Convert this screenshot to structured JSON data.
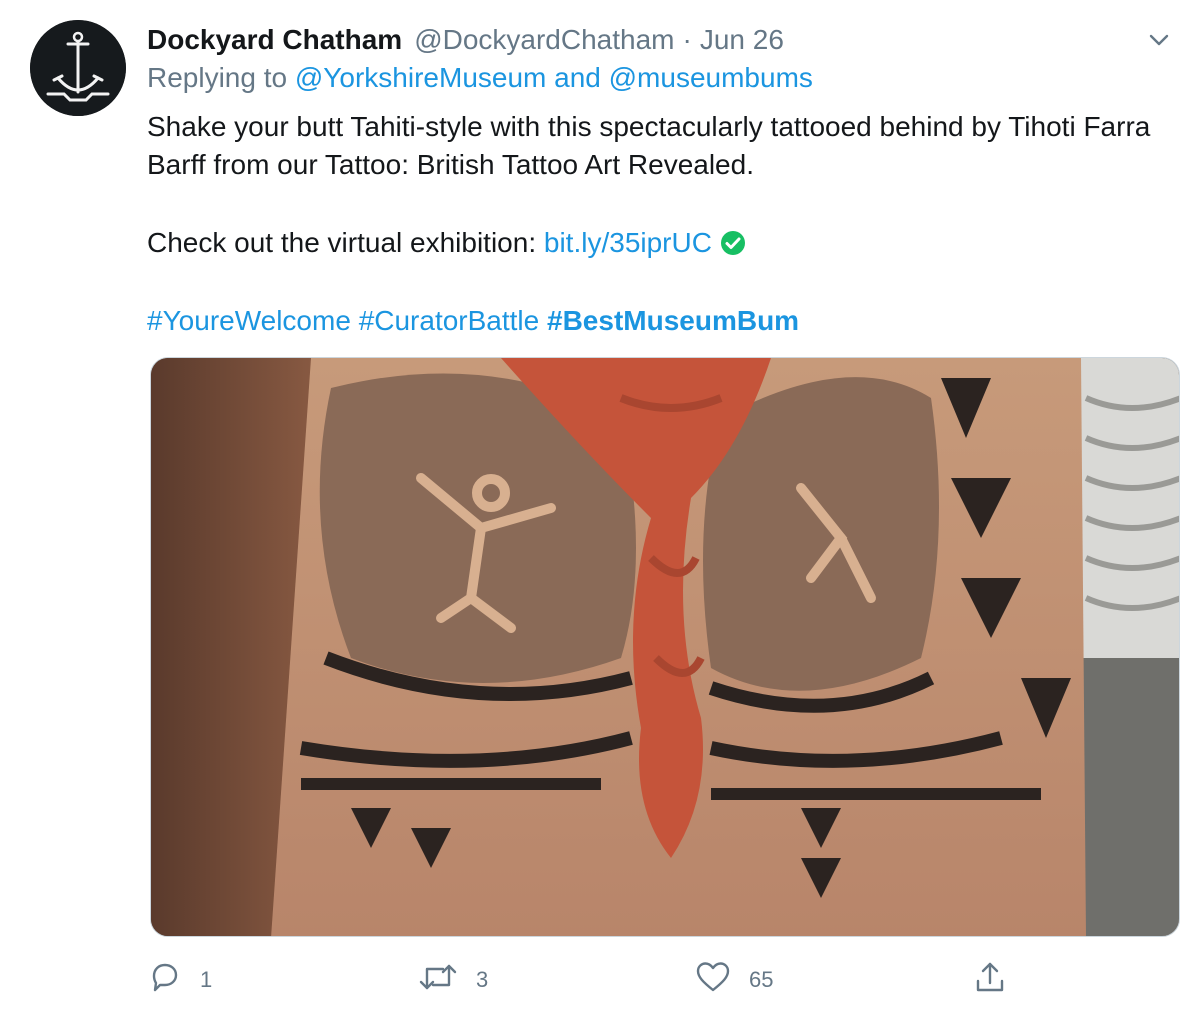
{
  "tweet": {
    "display_name": "Dockyard Chatham",
    "handle": "@DockyardChatham",
    "separator": "·",
    "date": "Jun 26",
    "reply_prefix": "Replying to",
    "reply_targets": "@YorkshireMuseum and @museumbums",
    "text_line1": "Shake your butt Tahiti-style with this spectacularly tattooed behind by Tihoti Farra Barff from our Tattoo: British Tattoo Art Revealed.",
    "cta_text": "Check out the virtual exhibition:",
    "cta_link": "bit.ly/35iprUC",
    "hashtag1": "#YoureWelcome",
    "hashtag2": "#CuratorBattle",
    "hashtag3": "#BestMuseumBum"
  },
  "actions": {
    "reply_count": "1",
    "retweet_count": "3",
    "like_count": "65",
    "share_icon": "share-icon"
  },
  "colors": {
    "link": "#1b95e0",
    "muted": "#657786",
    "verified": "#17bf63"
  }
}
